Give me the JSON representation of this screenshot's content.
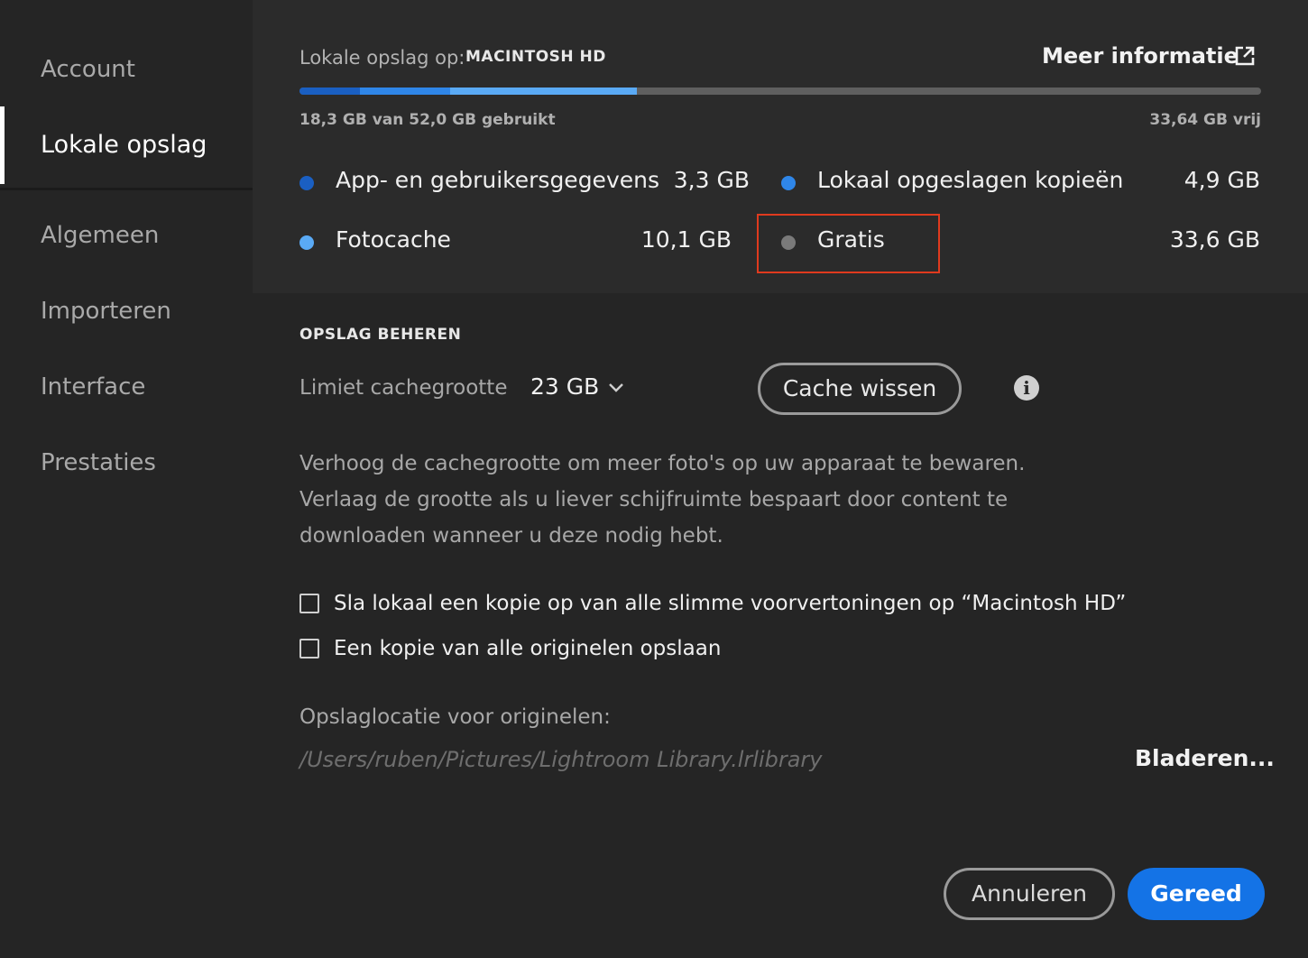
{
  "sidebar": {
    "items": [
      {
        "label": "Account"
      },
      {
        "label": "Lokale opslag",
        "active": true
      },
      {
        "label": "Algemeen"
      },
      {
        "label": "Importeren"
      },
      {
        "label": "Interface"
      },
      {
        "label": "Prestaties"
      }
    ]
  },
  "storage": {
    "label": "Lokale opslag op:",
    "disk_name": "MACINTOSH HD",
    "more_info": "Meer informatie",
    "more_info_icon": "external-link-icon",
    "used_text": "18,3 GB van 52,0 GB gebruikt",
    "free_text": "33,64 GB vrij",
    "usage_fractions": [
      {
        "name": "App- en gebruikersgegevens",
        "fraction": 0.063,
        "color": "#1a5fc2"
      },
      {
        "name": "Lokaal opgeslagen kopieën",
        "fraction": 0.094,
        "color": "#2f86e8"
      },
      {
        "name": "Fotocache",
        "fraction": 0.194,
        "color": "#5aaaf5"
      }
    ],
    "track_color": "#5f5f5f",
    "legend": [
      {
        "label": "App- en gebruikersgegevens",
        "value": "3,3 GB",
        "color": "#1a5fc2"
      },
      {
        "label": "Lokaal opgeslagen kopieën",
        "value": "4,9 GB",
        "color": "#2f86e8"
      },
      {
        "label": "Fotocache",
        "value": "10,1 GB",
        "color": "#5aaaf5"
      },
      {
        "label": "Gratis",
        "value": "33,6 GB",
        "color": "#7a7a7a"
      }
    ]
  },
  "manage": {
    "title": "OPSLAG BEHEREN",
    "cache_limit_label": "Limiet cachegrootte",
    "cache_limit_value": "23 GB",
    "clear_cache_button": "Cache wissen",
    "description": "Verhoog de cachegrootte om meer foto's op uw apparaat te bewaren. Verlaag de grootte als u liever schijfruimte bespaart door content te downloaden wanneer u deze nodig hebt.",
    "checkboxes": [
      {
        "label": "Sla lokaal een kopie op van alle slimme voorvertoningen op “Macintosh HD”",
        "checked": false
      },
      {
        "label": "Een kopie van alle originelen opslaan",
        "checked": false
      }
    ],
    "originals_location_label": "Opslaglocatie voor originelen:",
    "originals_path": "/Users/ruben/Pictures/Lightroom Library.lrlibrary",
    "browse_button": "Bladeren..."
  },
  "footer": {
    "cancel_button": "Annuleren",
    "done_button": "Gereed",
    "accent_color": "#1473e6"
  }
}
